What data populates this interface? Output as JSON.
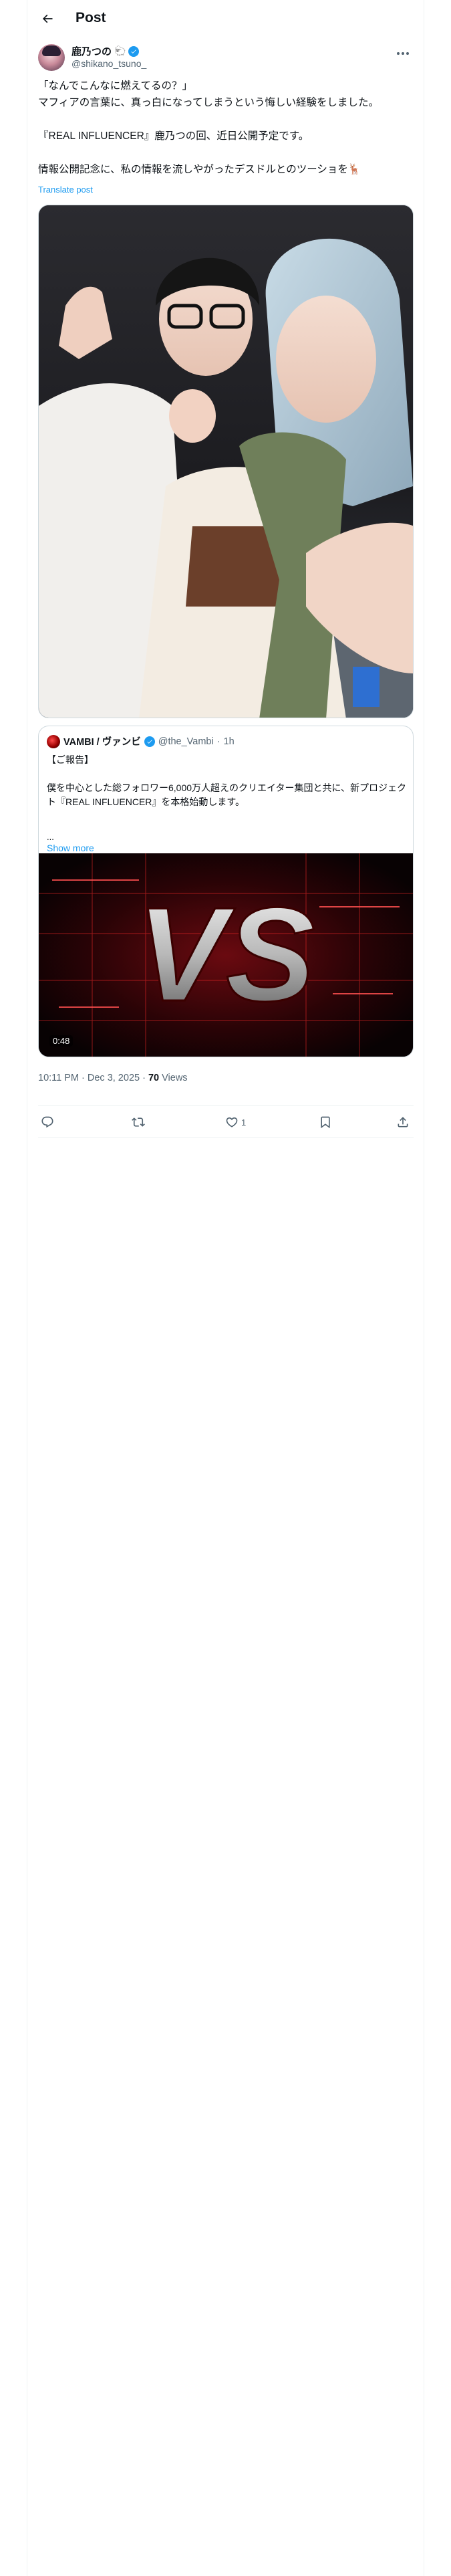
{
  "header": {
    "title": "Post",
    "back_icon": "arrow-left-icon"
  },
  "author": {
    "display_name": "鹿乃つの",
    "emoji": "🐑",
    "verified": true,
    "handle": "@shikano_tsuno_",
    "more_icon": "more-horizontal-icon"
  },
  "post": {
    "lines": [
      "「なんでこんなに燃えてるの？」",
      "マフィアの言葉に、真っ白になってしまうという悔しい経験をしました。",
      "",
      "『REAL INFLUENCER』鹿乃つの回、近日公開予定です。",
      "",
      "情報公開記念に、私の情報を流しやがったデスドルとのツーショを🦌"
    ],
    "translate_label": "Translate post"
  },
  "quote": {
    "display_name": "VAMBI / ヴァンビ",
    "verified": true,
    "handle": "@the_Vambi",
    "separator": "·",
    "time": "1h",
    "lines": [
      "【ご報告】",
      "",
      "僕を中心とした総フォロワー6,000万人超えのクリエイター集団と共に、新プロジェクト『REAL INFLUENCER』を本格始動します。"
    ],
    "ellipsis": "...",
    "show_more_label": "Show more",
    "video_title": "VS",
    "video_duration": "0:48"
  },
  "meta": {
    "timestamp": "10:11 PM · Dec 3, 2025 · ",
    "views_count": "70",
    "views_label": " Views"
  },
  "actions": {
    "reply_count": "",
    "repost_count": "",
    "like_count": "1",
    "bookmark_count": "",
    "icons": [
      "reply-icon",
      "repost-icon",
      "like-icon",
      "bookmark-icon",
      "share-icon"
    ]
  },
  "colors": {
    "accent": "#1d9bf0",
    "text_primary": "#0f1419",
    "text_secondary": "#536471",
    "border": "#eff3f4"
  }
}
